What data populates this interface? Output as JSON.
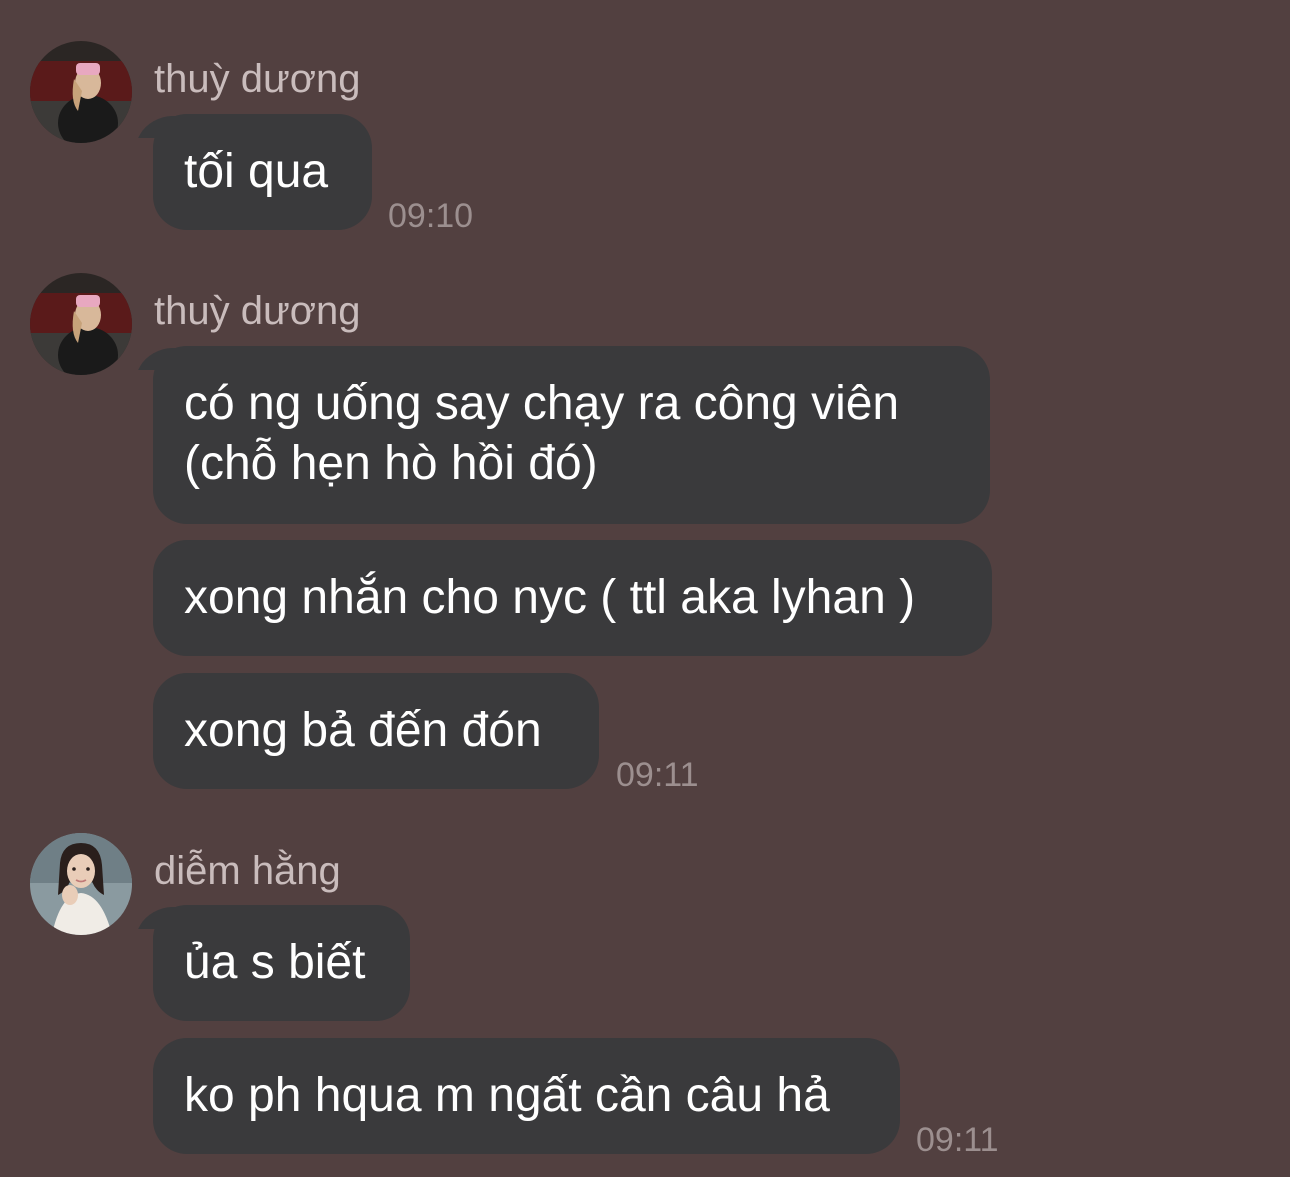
{
  "groups": [
    {
      "sender": "thuỳ dương",
      "avatar_icon": "profile-photo-thuy-duong",
      "messages": [
        "tối qua"
      ],
      "time": "09:10"
    },
    {
      "sender": "thuỳ dương",
      "avatar_icon": "profile-photo-thuy-duong",
      "messages": [
        "có ng uống say chạy ra công viên (chỗ hẹn hò hồi đó)",
        "xong nhắn cho nyc ( ttl aka lyhan )",
        "xong bả đến đón"
      ],
      "time": "09:11"
    },
    {
      "sender": "diễm hằng",
      "avatar_icon": "profile-photo-diem-hang",
      "messages": [
        "ủa s biết",
        "ko ph hqua m ngất cần câu hả"
      ],
      "time": "09:11"
    }
  ],
  "colors": {
    "background": "#524040",
    "bubble": "#3a3a3c",
    "message_text": "#ffffff",
    "sender_text": "#c9bcbc",
    "time_text": "#9c8f8f"
  }
}
